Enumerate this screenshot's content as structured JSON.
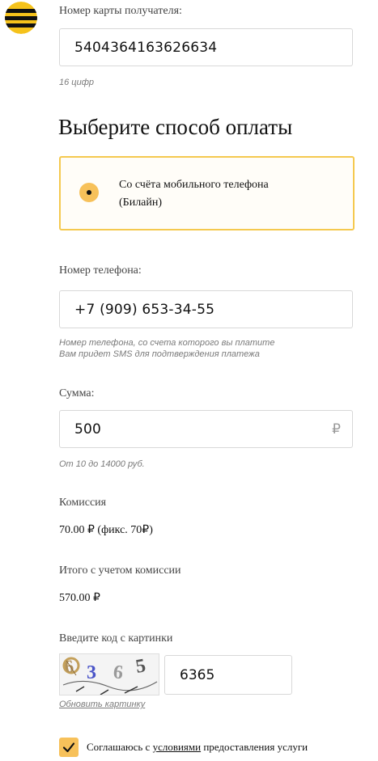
{
  "card": {
    "label": "Номер карты получателя:",
    "value": "5404364163626634",
    "hint": "16 цифр"
  },
  "payment": {
    "title": "Выберите способ оплаты",
    "option_line1": "Со счёта мобильного телефона",
    "option_line2": "(Билайн)"
  },
  "phone": {
    "label": "Номер телефона:",
    "value": "+7 (909) 653-34-55",
    "hint_line1": "Номер телефона, со счета которого вы платите",
    "hint_line2": "Вам придет SMS для подтверждения платежа"
  },
  "amount": {
    "label": "Сумма:",
    "value": "500",
    "currency": "₽",
    "hint": "От 10 до 14000 руб."
  },
  "commission": {
    "label": "Комиссия",
    "value": "70.00 ₽ (фикс. 70₽)"
  },
  "total": {
    "label": "Итого с учетом комиссии",
    "value": "570.00 ₽"
  },
  "captcha": {
    "label": "Введите код с картинки",
    "image_text": "6365",
    "value": "6365",
    "refresh": "Обновить картинку"
  },
  "agreement": {
    "prefix": "Соглашаюсь с ",
    "link": "условиями",
    "suffix": " предоставления услуги"
  },
  "colors": {
    "accent": "#f7c15a",
    "border_active": "#f5c94f"
  }
}
